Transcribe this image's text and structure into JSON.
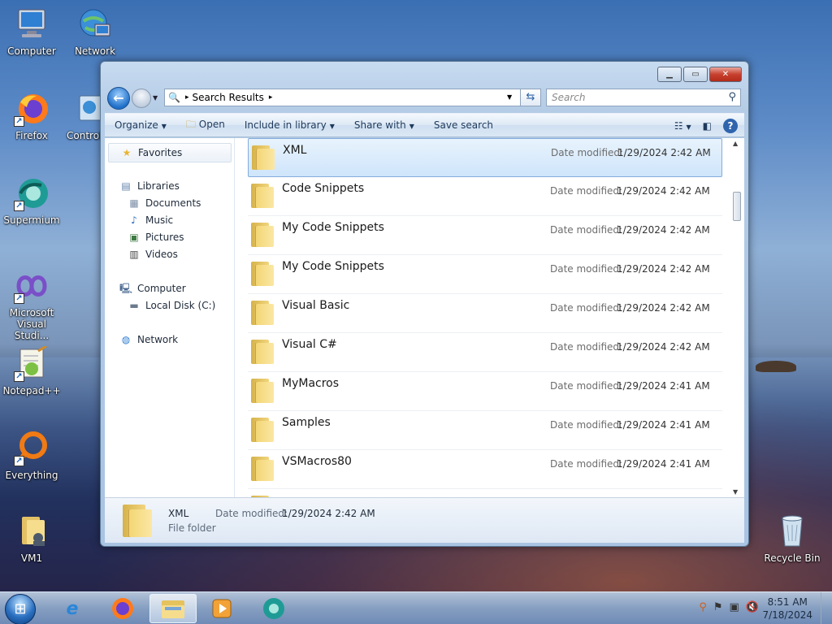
{
  "desktop": {
    "icons": [
      {
        "label": "Computer",
        "icon": "computer-icon"
      },
      {
        "label": "Network",
        "icon": "network-icon"
      },
      {
        "label": "Firefox",
        "icon": "firefox-icon"
      },
      {
        "label": "Control",
        "icon": "control-panel-icon"
      },
      {
        "label": "Supermium",
        "icon": "supermium-icon"
      },
      {
        "label": "Microsoft Visual Studi...",
        "icon": "visual-studio-icon"
      },
      {
        "label": "Notepad++",
        "icon": "notepadpp-icon"
      },
      {
        "label": "Everything",
        "icon": "everything-icon"
      },
      {
        "label": "VM1",
        "icon": "user-folder-icon"
      },
      {
        "label": "Recycle Bin",
        "icon": "recycle-bin-icon"
      }
    ]
  },
  "window": {
    "address": {
      "segment": "Search Results"
    },
    "search_placeholder": "Search",
    "toolbar": {
      "organize": "Organize",
      "open": "Open",
      "include_in_library": "Include in library",
      "share_with": "Share with",
      "save_search": "Save search"
    },
    "nav": {
      "favorites": "Favorites",
      "libraries": "Libraries",
      "documents": "Documents",
      "music": "Music",
      "pictures": "Pictures",
      "videos": "Videos",
      "computer": "Computer",
      "local_disk": "Local Disk (C:)",
      "network": "Network"
    },
    "date_modified_label": "Date modified:",
    "files": [
      {
        "name": "XML",
        "date": "1/29/2024 2:42 AM",
        "selected": true
      },
      {
        "name": "Code Snippets",
        "date": "1/29/2024 2:42 AM"
      },
      {
        "name": "My Code Snippets",
        "date": "1/29/2024 2:42 AM"
      },
      {
        "name": "My Code Snippets",
        "date": "1/29/2024 2:42 AM"
      },
      {
        "name": "Visual Basic",
        "date": "1/29/2024 2:42 AM"
      },
      {
        "name": "Visual C#",
        "date": "1/29/2024 2:42 AM"
      },
      {
        "name": "MyMacros",
        "date": "1/29/2024 2:41 AM"
      },
      {
        "name": "Samples",
        "date": "1/29/2024 2:41 AM"
      },
      {
        "name": "VSMacros80",
        "date": "1/29/2024 2:41 AM"
      }
    ],
    "details": {
      "name": "XML",
      "date_label": "Date modified:",
      "date": "1/29/2024 2:42 AM",
      "type": "File folder"
    }
  },
  "taskbar": {
    "items": [
      "internet-explorer-icon",
      "firefox-icon",
      "explorer-icon",
      "media-player-icon",
      "supermium-icon"
    ],
    "clock": {
      "time": "8:51 AM",
      "date": "7/18/2024"
    }
  }
}
